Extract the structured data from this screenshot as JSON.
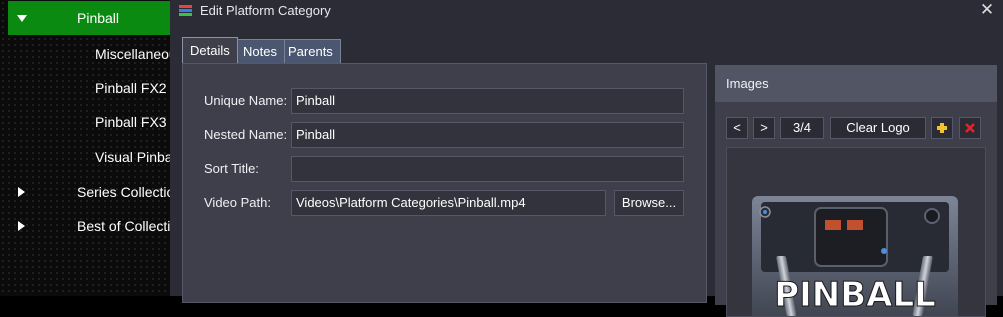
{
  "tree": {
    "selected": {
      "label": "Pinball"
    },
    "children": [
      {
        "label": "Miscellaneous"
      },
      {
        "label": "Pinball FX2"
      },
      {
        "label": "Pinball FX3"
      },
      {
        "label": "Visual Pinball"
      }
    ],
    "collapsed": [
      {
        "label": "Series Collections"
      },
      {
        "label": "Best of Collections"
      }
    ],
    "selected_color": "#0b8a11"
  },
  "dialog": {
    "title": "Edit Platform Category",
    "close_glyph": "✕",
    "tabs": [
      {
        "label": "Details",
        "active": true
      },
      {
        "label": "Notes",
        "active": false
      },
      {
        "label": "Parents",
        "active": false
      }
    ],
    "fields": {
      "unique_name": {
        "label": "Unique Name:",
        "value": "Pinball"
      },
      "nested_name": {
        "label": "Nested Name:",
        "value": "Pinball"
      },
      "sort_title": {
        "label": "Sort Title:",
        "value": ""
      },
      "video_path": {
        "label": "Video Path:",
        "value": "Videos\\Platform Categories\\Pinball.mp4"
      }
    },
    "browse_label": "Browse..."
  },
  "images": {
    "header": "Images",
    "prev_label": "<",
    "next_label": ">",
    "counter": "3/4",
    "clear_label": "Clear Logo",
    "add_icon": "plus-icon",
    "remove_icon": "remove-icon",
    "logo_text": "PINBALL"
  }
}
